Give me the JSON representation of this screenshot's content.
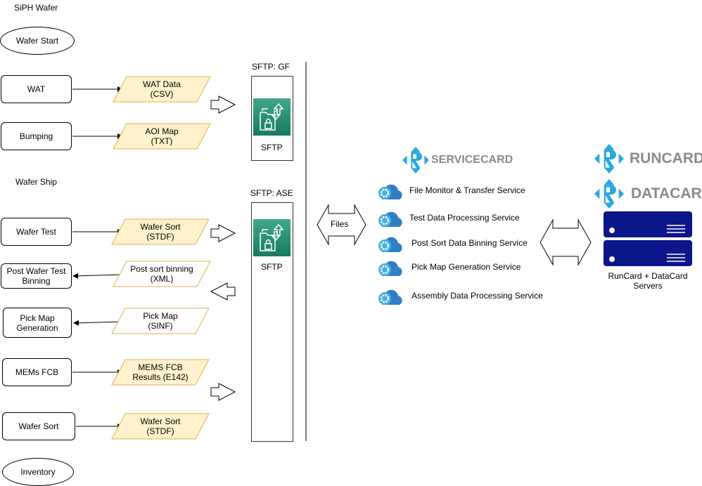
{
  "title": "SiPH Wafer",
  "process_steps": [
    {
      "label": "Wafer Start",
      "shape": "ellipse"
    },
    {
      "label": "WAT"
    },
    {
      "label": "Bumping"
    },
    {
      "label": "Wafer Ship"
    },
    {
      "label": "Wafer Test"
    },
    {
      "label": "Post Wafer Test Binning"
    },
    {
      "label": "Pick Map Generation"
    },
    {
      "label": "MEMs FCB"
    },
    {
      "label": "Wafer Sort"
    },
    {
      "label": "Inventory",
      "shape": "ellipse"
    }
  ],
  "data_files": [
    {
      "line1": "WAT Data",
      "line2": "(CSV)"
    },
    {
      "line1": "AOI Map",
      "line2": "(TXT)"
    },
    {
      "line1": "Wafer Sort",
      "line2": "(STDF)"
    },
    {
      "line1": "Post sort binning",
      "line2": "(XML)"
    },
    {
      "line1": "Pick Map",
      "line2": "(SINF)"
    },
    {
      "line1": "MEMS FCB",
      "line2": "Results (E142)"
    },
    {
      "line1": "Wafer Sort",
      "line2": "(STDF)"
    }
  ],
  "sftp": [
    {
      "header": "SFTP: GF",
      "label": "SFTP"
    },
    {
      "header": "SFTP: ASE",
      "label": "SFTP"
    }
  ],
  "files_label": "Files",
  "servicecard": {
    "logo": "SERVICECARD",
    "services": [
      "File Monitor & Transfer Service",
      "Test Data Processing Service",
      "Post Sort Data Binning Service",
      "Pick Map Generation Service",
      "Assembly Data Processing Service"
    ]
  },
  "runcard_logo": "RUNCARD",
  "datacard_logo": "DATACARD",
  "servers_caption_1": "RunCard + DataCard",
  "servers_caption_2": "Servers",
  "colors": {
    "file_fill": "#fff2cc",
    "file_border": "#d6b656",
    "logo_blue": "#29a8e0",
    "server": "#0b168a",
    "sftp_green": "#2e9a78",
    "cloud": "#2f7fc4"
  }
}
